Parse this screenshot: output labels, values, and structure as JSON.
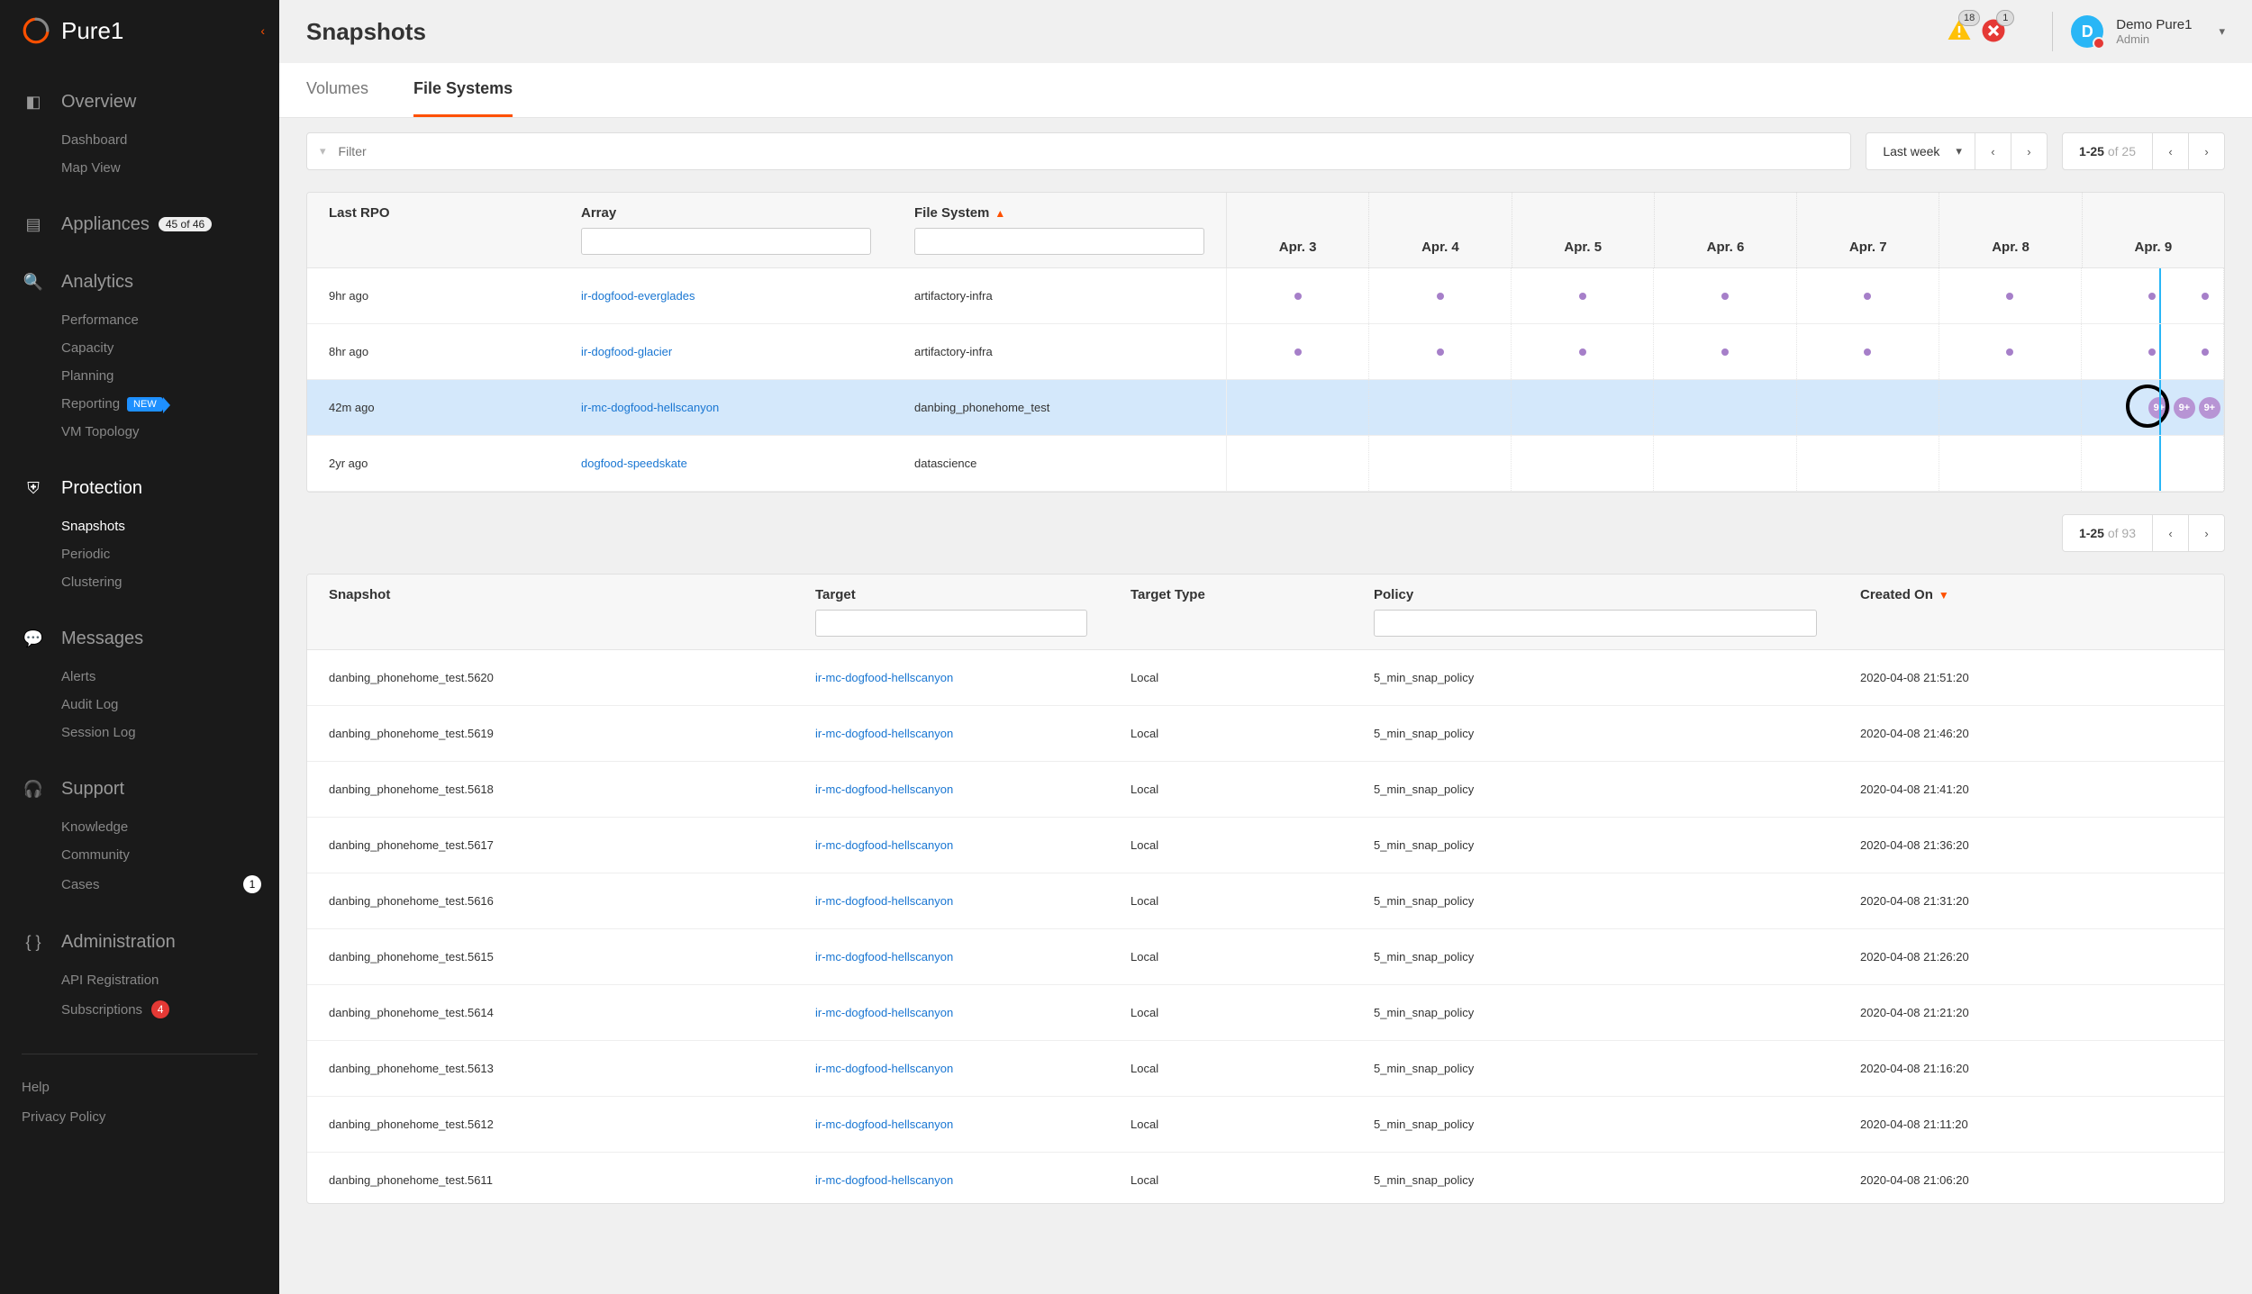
{
  "brand": "Pure1",
  "page_title": "Snapshots",
  "alerts": {
    "warn": "18",
    "err": "1"
  },
  "user": {
    "initial": "D",
    "name": "Demo Pure1",
    "role": "Admin"
  },
  "sidebar": {
    "overview": {
      "label": "Overview",
      "items": [
        "Dashboard",
        "Map View"
      ]
    },
    "appliances": {
      "label": "Appliances",
      "badge": "45 of 46"
    },
    "analytics": {
      "label": "Analytics",
      "items": [
        "Performance",
        "Capacity",
        "Planning",
        "Reporting",
        "VM Topology"
      ],
      "new_item": "Reporting",
      "new_badge": "NEW"
    },
    "protection": {
      "label": "Protection",
      "items": [
        "Snapshots",
        "Periodic",
        "Clustering"
      ],
      "active": "Snapshots"
    },
    "messages": {
      "label": "Messages",
      "items": [
        "Alerts",
        "Audit Log",
        "Session Log"
      ]
    },
    "support": {
      "label": "Support",
      "items": [
        "Knowledge",
        "Community",
        "Cases"
      ],
      "cases_badge": "1"
    },
    "admin": {
      "label": "Administration",
      "items": [
        "API Registration",
        "Subscriptions"
      ],
      "subs_badge": "4"
    },
    "footer": [
      "Help",
      "Privacy Policy"
    ]
  },
  "tabs": [
    "Volumes",
    "File Systems"
  ],
  "active_tab": "File Systems",
  "filter_placeholder": "Filter",
  "range": {
    "label": "Last week"
  },
  "pager1": {
    "range": "1-25",
    "of": " of 25"
  },
  "pager2": {
    "range": "1-25",
    "of": " of 93"
  },
  "headers1": {
    "rpo": "Last RPO",
    "array": "Array",
    "fs": "File System"
  },
  "dates": [
    "Apr. 3",
    "Apr. 4",
    "Apr. 5",
    "Apr. 6",
    "Apr. 7",
    "Apr. 8",
    "Apr. 9"
  ],
  "rows": [
    {
      "rpo": "9hr ago",
      "array": "ir-dogfood-everglades",
      "fs": "artifactory-infra",
      "pattern": "dots",
      "hl": false
    },
    {
      "rpo": "8hr ago",
      "array": "ir-dogfood-glacier",
      "fs": "artifactory-infra",
      "pattern": "dots",
      "hl": false
    },
    {
      "rpo": "42m ago",
      "array": "ir-mc-dogfood-hellscanyon",
      "fs": "danbing_phonehome_test",
      "pattern": "cluster",
      "hl": true
    },
    {
      "rpo": "2yr ago",
      "array": "dogfood-speedskate",
      "fs": "datascience",
      "pattern": "empty",
      "hl": false
    }
  ],
  "headers2": {
    "snap": "Snapshot",
    "target": "Target",
    "ttype": "Target Type",
    "policy": "Policy",
    "created": "Created On"
  },
  "snapshots": [
    {
      "name": "danbing_phonehome_test.5620",
      "target": "ir-mc-dogfood-hellscanyon",
      "ttype": "Local",
      "policy": "5_min_snap_policy",
      "created": "2020-04-08 21:51:20"
    },
    {
      "name": "danbing_phonehome_test.5619",
      "target": "ir-mc-dogfood-hellscanyon",
      "ttype": "Local",
      "policy": "5_min_snap_policy",
      "created": "2020-04-08 21:46:20"
    },
    {
      "name": "danbing_phonehome_test.5618",
      "target": "ir-mc-dogfood-hellscanyon",
      "ttype": "Local",
      "policy": "5_min_snap_policy",
      "created": "2020-04-08 21:41:20"
    },
    {
      "name": "danbing_phonehome_test.5617",
      "target": "ir-mc-dogfood-hellscanyon",
      "ttype": "Local",
      "policy": "5_min_snap_policy",
      "created": "2020-04-08 21:36:20"
    },
    {
      "name": "danbing_phonehome_test.5616",
      "target": "ir-mc-dogfood-hellscanyon",
      "ttype": "Local",
      "policy": "5_min_snap_policy",
      "created": "2020-04-08 21:31:20"
    },
    {
      "name": "danbing_phonehome_test.5615",
      "target": "ir-mc-dogfood-hellscanyon",
      "ttype": "Local",
      "policy": "5_min_snap_policy",
      "created": "2020-04-08 21:26:20"
    },
    {
      "name": "danbing_phonehome_test.5614",
      "target": "ir-mc-dogfood-hellscanyon",
      "ttype": "Local",
      "policy": "5_min_snap_policy",
      "created": "2020-04-08 21:21:20"
    },
    {
      "name": "danbing_phonehome_test.5613",
      "target": "ir-mc-dogfood-hellscanyon",
      "ttype": "Local",
      "policy": "5_min_snap_policy",
      "created": "2020-04-08 21:16:20"
    },
    {
      "name": "danbing_phonehome_test.5612",
      "target": "ir-mc-dogfood-hellscanyon",
      "ttype": "Local",
      "policy": "5_min_snap_policy",
      "created": "2020-04-08 21:11:20"
    },
    {
      "name": "danbing_phonehome_test.5611",
      "target": "ir-mc-dogfood-hellscanyon",
      "ttype": "Local",
      "policy": "5_min_snap_policy",
      "created": "2020-04-08 21:06:20"
    }
  ],
  "cluster_label": "9+"
}
